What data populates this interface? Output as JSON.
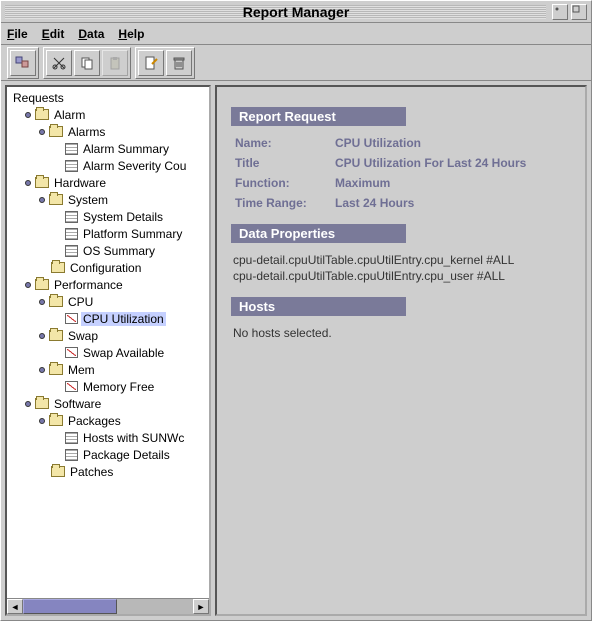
{
  "window": {
    "title": "Report Manager"
  },
  "menu": {
    "file": "File",
    "edit": "Edit",
    "data": "Data",
    "help": "Help"
  },
  "toolbar": {
    "new_report": "new-report",
    "cut": "cut",
    "copy": "copy",
    "paste": "paste",
    "edit": "edit",
    "delete": "delete"
  },
  "tree": {
    "root": "Requests",
    "alarm": "Alarm",
    "alarms": "Alarms",
    "alarm_summary": "Alarm Summary",
    "alarm_severity": "Alarm Severity Cou",
    "hardware": "Hardware",
    "system": "System",
    "system_details": "System Details",
    "platform_summary": "Platform Summary",
    "os_summary": "OS Summary",
    "configuration": "Configuration",
    "performance": "Performance",
    "cpu": "CPU",
    "cpu_utilization": "CPU Utilization",
    "swap": "Swap",
    "swap_available": "Swap Available",
    "mem": "Mem",
    "memory_free": "Memory Free",
    "software": "Software",
    "packages": "Packages",
    "hosts_sunwc": "Hosts with SUNWc",
    "package_details": "Package Details",
    "patches": "Patches"
  },
  "detail": {
    "report_request_header": "Report Request",
    "name_label": "Name:",
    "name_value": "CPU Utilization",
    "title_label": "Title",
    "title_value": "CPU Utilization For Last 24 Hours",
    "function_label": "Function:",
    "function_value": "Maximum",
    "timerange_label": "Time Range:",
    "timerange_value": "Last 24 Hours",
    "data_properties_header": "Data Properties",
    "data_items": [
      "cpu-detail.cpuUtilTable.cpuUtilEntry.cpu_kernel #ALL",
      "cpu-detail.cpuUtilTable.cpuUtilEntry.cpu_user #ALL"
    ],
    "hosts_header": "Hosts",
    "hosts_text": "No hosts selected."
  }
}
